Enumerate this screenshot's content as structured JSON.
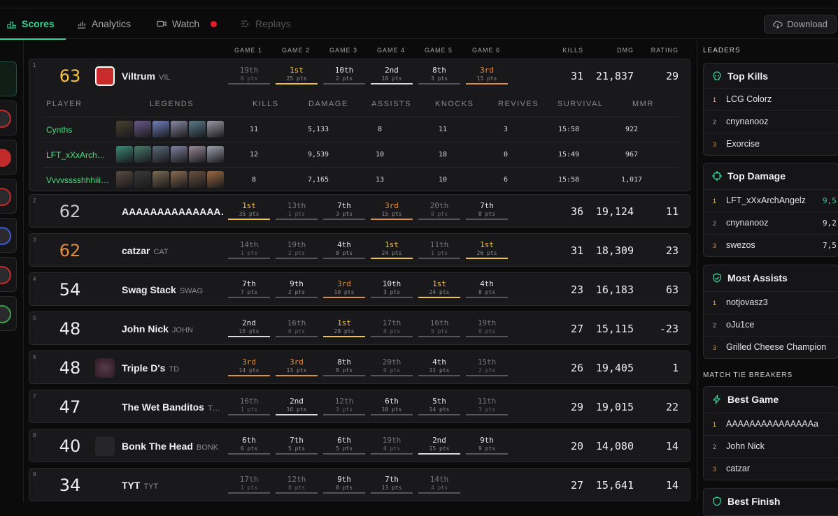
{
  "nav": {
    "tabs": [
      {
        "label": "Scores",
        "icon": "podium-icon",
        "active": true
      },
      {
        "label": "Analytics",
        "icon": "chart-icon"
      },
      {
        "label": "Watch",
        "icon": "video-icon",
        "live": true
      },
      {
        "label": "Replays",
        "icon": "list-icon",
        "disabled": true
      }
    ],
    "download_label": "Download"
  },
  "columns": {
    "games": [
      "GAME 1",
      "GAME 2",
      "GAME 3",
      "GAME 4",
      "GAME 5",
      "GAME 6"
    ],
    "kills": "KILLS",
    "damage": "DMG",
    "rating": "RATING"
  },
  "subtable": {
    "headers": [
      "PLAYER",
      "LEGENDS",
      "KILLS",
      "DAMAGE",
      "ASSISTS",
      "KNOCKS",
      "REVIVES",
      "SURVIVAL",
      "MMR"
    ],
    "players": [
      {
        "name": "Cynths",
        "kills": "11",
        "damage": "5,133",
        "assists": "8",
        "knocks": "11",
        "revives": "3",
        "survival": "15:58",
        "mmr": "922"
      },
      {
        "name": "LFT_xXxArch…",
        "kills": "12",
        "damage": "9,539",
        "assists": "10",
        "knocks": "18",
        "revives": "0",
        "survival": "15:49",
        "mmr": "967"
      },
      {
        "name": "Vvvvsssshhhiii…",
        "kills": "8",
        "damage": "7,165",
        "assists": "13",
        "knocks": "10",
        "revives": "6",
        "survival": "15:58",
        "mmr": "1,017"
      }
    ]
  },
  "teams": [
    {
      "rank": "1",
      "points": "63",
      "tier": "gold",
      "name": "Viltrum",
      "tag": "VIL",
      "logo": "viltrum",
      "kills": "31",
      "damage": "21,837",
      "rating": "29",
      "games": [
        {
          "p": "19th",
          "pts": "0 pts",
          "c": "dim"
        },
        {
          "p": "1st",
          "pts": "25 pts",
          "c": "gold"
        },
        {
          "p": "10th",
          "pts": "2 pts",
          "c": ""
        },
        {
          "p": "2nd",
          "pts": "18 pts",
          "c": "silver"
        },
        {
          "p": "8th",
          "pts": "3 pts",
          "c": ""
        },
        {
          "p": "3rd",
          "pts": "15 pts",
          "c": "bronze"
        }
      ]
    },
    {
      "rank": "2",
      "points": "62",
      "tier": "silver",
      "name": "AAAAAAAAAAAAAA…",
      "tag": "",
      "logo": "",
      "kills": "36",
      "damage": "19,124",
      "rating": "11",
      "games": [
        {
          "p": "1st",
          "pts": "35 pts",
          "c": "gold"
        },
        {
          "p": "13th",
          "pts": "1 pts",
          "c": "dim"
        },
        {
          "p": "7th",
          "pts": "3 pts",
          "c": ""
        },
        {
          "p": "3rd",
          "pts": "15 pts",
          "c": "bronze"
        },
        {
          "p": "20th",
          "pts": "0 pts",
          "c": "dim"
        },
        {
          "p": "7th",
          "pts": "8 pts",
          "c": ""
        }
      ]
    },
    {
      "rank": "3",
      "points": "62",
      "tier": "bronze",
      "name": "catzar",
      "tag": "CAT",
      "logo": "",
      "kills": "31",
      "damage": "18,309",
      "rating": "23",
      "games": [
        {
          "p": "14th",
          "pts": "1 pts",
          "c": "dim"
        },
        {
          "p": "19th",
          "pts": "2 pts",
          "c": "dim"
        },
        {
          "p": "4th",
          "pts": "8 pts",
          "c": ""
        },
        {
          "p": "1st",
          "pts": "24 pts",
          "c": "gold"
        },
        {
          "p": "11th",
          "pts": "1 pts",
          "c": "dim"
        },
        {
          "p": "1st",
          "pts": "26 pts",
          "c": "gold"
        }
      ]
    },
    {
      "rank": "4",
      "points": "54",
      "tier": "",
      "name": "Swag Stack",
      "tag": "SWAG",
      "logo": "",
      "kills": "23",
      "damage": "16,183",
      "rating": "63",
      "games": [
        {
          "p": "7th",
          "pts": "7 pts",
          "c": ""
        },
        {
          "p": "9th",
          "pts": "2 pts",
          "c": ""
        },
        {
          "p": "3rd",
          "pts": "10 pts",
          "c": "bronze"
        },
        {
          "p": "10th",
          "pts": "3 pts",
          "c": ""
        },
        {
          "p": "1st",
          "pts": "24 pts",
          "c": "gold"
        },
        {
          "p": "4th",
          "pts": "8 pts",
          "c": ""
        }
      ]
    },
    {
      "rank": "5",
      "points": "48",
      "tier": "",
      "name": "John Nick",
      "tag": "JOHN",
      "logo": "",
      "kills": "27",
      "damage": "15,115",
      "rating": "-23",
      "games": [
        {
          "p": "2nd",
          "pts": "15 pts",
          "c": "silver"
        },
        {
          "p": "16th",
          "pts": "0 pts",
          "c": "dim"
        },
        {
          "p": "1st",
          "pts": "28 pts",
          "c": "gold"
        },
        {
          "p": "17th",
          "pts": "0 pts",
          "c": "dim"
        },
        {
          "p": "16th",
          "pts": "5 pts",
          "c": "dim"
        },
        {
          "p": "19th",
          "pts": "0 pts",
          "c": "dim"
        }
      ]
    },
    {
      "rank": "6",
      "points": "48",
      "tier": "",
      "name": "Triple D's",
      "tag": "TD",
      "logo": "tripled",
      "kills": "26",
      "damage": "19,405",
      "rating": "1",
      "games": [
        {
          "p": "3rd",
          "pts": "14 pts",
          "c": "bronze"
        },
        {
          "p": "3rd",
          "pts": "13 pts",
          "c": "bronze"
        },
        {
          "p": "8th",
          "pts": "8 pts",
          "c": ""
        },
        {
          "p": "20th",
          "pts": "0 pts",
          "c": "dim"
        },
        {
          "p": "4th",
          "pts": "11 pts",
          "c": ""
        },
        {
          "p": "15th",
          "pts": "2 pts",
          "c": "dim"
        }
      ]
    },
    {
      "rank": "7",
      "points": "47",
      "tier": "",
      "name": "The Wet Banditos",
      "tag": "T…",
      "logo": "",
      "kills": "29",
      "damage": "19,015",
      "rating": "22",
      "games": [
        {
          "p": "16th",
          "pts": "1 pts",
          "c": "dim"
        },
        {
          "p": "2nd",
          "pts": "16 pts",
          "c": "silver"
        },
        {
          "p": "12th",
          "pts": "3 pts",
          "c": "dim"
        },
        {
          "p": "6th",
          "pts": "10 pts",
          "c": ""
        },
        {
          "p": "5th",
          "pts": "14 pts",
          "c": ""
        },
        {
          "p": "11th",
          "pts": "3 pts",
          "c": "dim"
        }
      ]
    },
    {
      "rank": "8",
      "points": "40",
      "tier": "",
      "name": "Bonk The Head",
      "tag": "BONK",
      "logo": "bonk",
      "kills": "20",
      "damage": "14,080",
      "rating": "14",
      "games": [
        {
          "p": "6th",
          "pts": "6 pts",
          "c": ""
        },
        {
          "p": "7th",
          "pts": "5 pts",
          "c": ""
        },
        {
          "p": "6th",
          "pts": "5 pts",
          "c": ""
        },
        {
          "p": "19th",
          "pts": "0 pts",
          "c": "dim"
        },
        {
          "p": "2nd",
          "pts": "15 pts",
          "c": "silver"
        },
        {
          "p": "9th",
          "pts": "9 pts",
          "c": ""
        }
      ]
    },
    {
      "rank": "9",
      "points": "34",
      "tier": "",
      "name": "TYT",
      "tag": "TYT",
      "logo": "",
      "kills": "27",
      "damage": "15,641",
      "rating": "14",
      "games": [
        {
          "p": "17th",
          "pts": "1 pts",
          "c": "dim"
        },
        {
          "p": "12th",
          "pts": "8 pts",
          "c": "dim"
        },
        {
          "p": "9th",
          "pts": "8 pts",
          "c": ""
        },
        {
          "p": "7th",
          "pts": "13 pts",
          "c": ""
        },
        {
          "p": "14th",
          "pts": "4 pts",
          "c": "dim"
        }
      ]
    }
  ],
  "sidebar": {
    "leaders_title": "LEADERS",
    "tiebreak_title": "MATCH TIE BREAKERS",
    "top_kills": {
      "title": "Top Kills",
      "icon": "skull-icon",
      "rows": [
        {
          "n": "1",
          "name": "LCG Colorz",
          "val": ""
        },
        {
          "n": "2",
          "name": "cnynanooz",
          "val": ""
        },
        {
          "n": "3",
          "name": "Exorcise",
          "val": ""
        }
      ]
    },
    "top_damage": {
      "title": "Top Damage",
      "icon": "crosshair-icon",
      "rows": [
        {
          "n": "1",
          "name": "LFT_xXxArchAngelz",
          "val": "9,5"
        },
        {
          "n": "2",
          "name": "cnynanooz",
          "val": "9,2"
        },
        {
          "n": "3",
          "name": "swezos",
          "val": "7,5"
        }
      ]
    },
    "most_assists": {
      "title": "Most Assists",
      "icon": "shield-icon",
      "rows": [
        {
          "n": "1",
          "name": "notjovasz3",
          "val": ""
        },
        {
          "n": "2",
          "name": "oJu1ce",
          "val": ""
        },
        {
          "n": "3",
          "name": "Grilled Cheese Champion",
          "val": ""
        }
      ]
    },
    "best_game": {
      "title": "Best Game",
      "icon": "bolt-icon",
      "rows": [
        {
          "n": "1",
          "name": "AAAAAAAAAAAAAAAa",
          "val": ""
        },
        {
          "n": "2",
          "name": "John Nick",
          "val": ""
        },
        {
          "n": "3",
          "name": "catzar",
          "val": ""
        }
      ]
    },
    "best_finish": {
      "title": "Best Finish",
      "icon": "shield-icon"
    }
  },
  "colors": {
    "accent": "#34d399",
    "gold": "#f6c244",
    "bronze": "#e08e3c",
    "player": "#4ade80"
  }
}
